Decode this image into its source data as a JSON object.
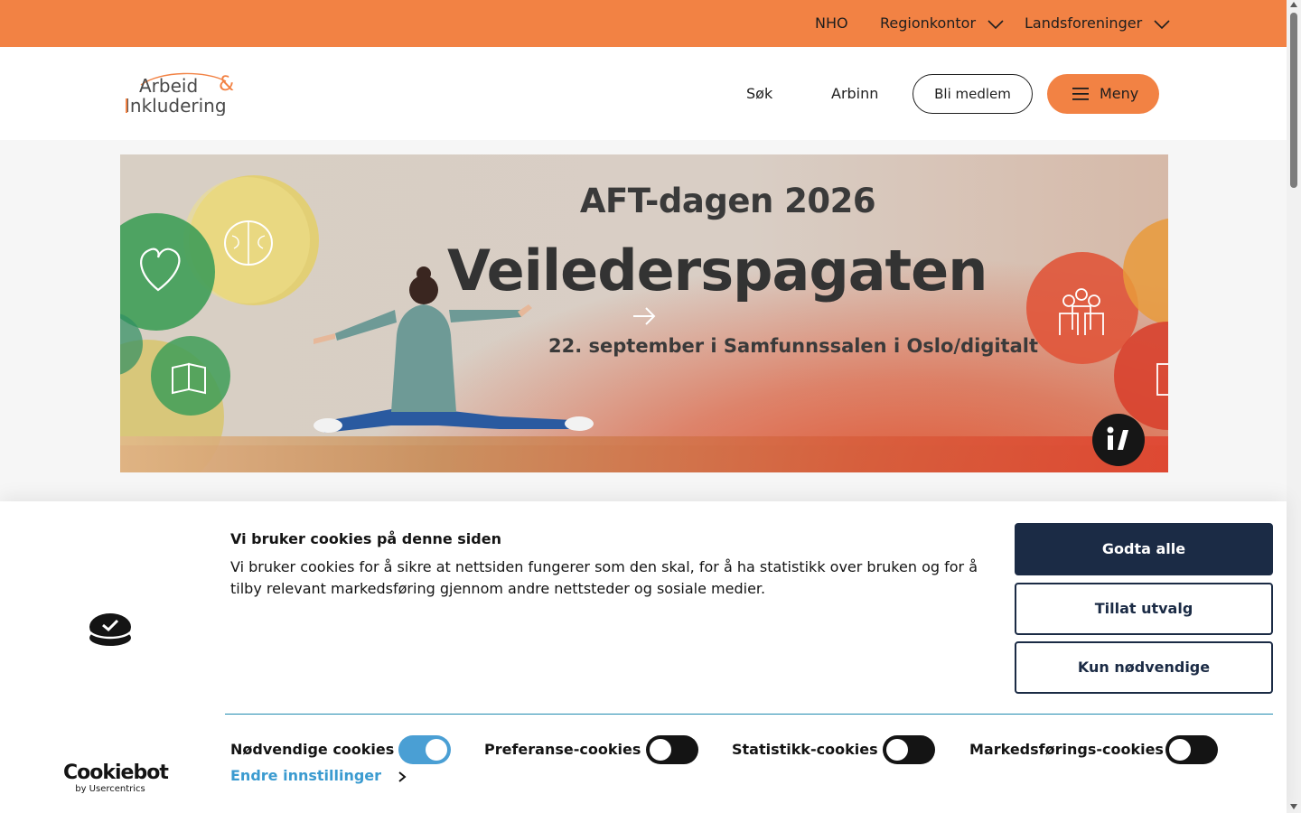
{
  "topbar": {
    "items": [
      {
        "label": "NHO"
      },
      {
        "label": "Regionkontor"
      },
      {
        "label": "Landsforeninger"
      }
    ]
  },
  "header": {
    "logo_line1": "Arbeid",
    "logo_amp": "&",
    "logo_line2": "Inkludering",
    "nav": {
      "search": "Søk",
      "arbinn": "Arbinn"
    },
    "member_button": "Bli medlem",
    "menu_button": "Meny"
  },
  "hero": {
    "subtitle": "AFT-dagen 2026",
    "title": "Veilederspagaten",
    "date_line": "22. september i Samfunnssalen i Oslo/digitalt"
  },
  "cookie_banner": {
    "title": "Vi bruker cookies på denne siden",
    "text": "Vi bruker cookies for å sikre at nettsiden fungerer som den skal, for å ha statistikk over bruken og for å tilby relevant markedsføring gjennom andre nettsteder og sosiale medier.",
    "buttons": {
      "accept_all": "Godta alle",
      "allow_selection": "Tillat utvalg",
      "necessary_only": "Kun nødvendige"
    },
    "toggles": [
      {
        "label": "Nødvendige cookies",
        "on": true
      },
      {
        "label": "Preferanse-cookies",
        "on": false
      },
      {
        "label": "Statistikk-cookies",
        "on": false
      },
      {
        "label": "Markedsførings-cookies",
        "on": false
      }
    ],
    "settings_link": "Endre innstillinger",
    "brand": {
      "name": "Cookiebot",
      "by": "by Usercentrics"
    }
  },
  "colors": {
    "brand_orange": "#f28244",
    "navy": "#1b2b45",
    "toggle_on": "#4a9fd4",
    "link_blue": "#3b9bd0"
  }
}
